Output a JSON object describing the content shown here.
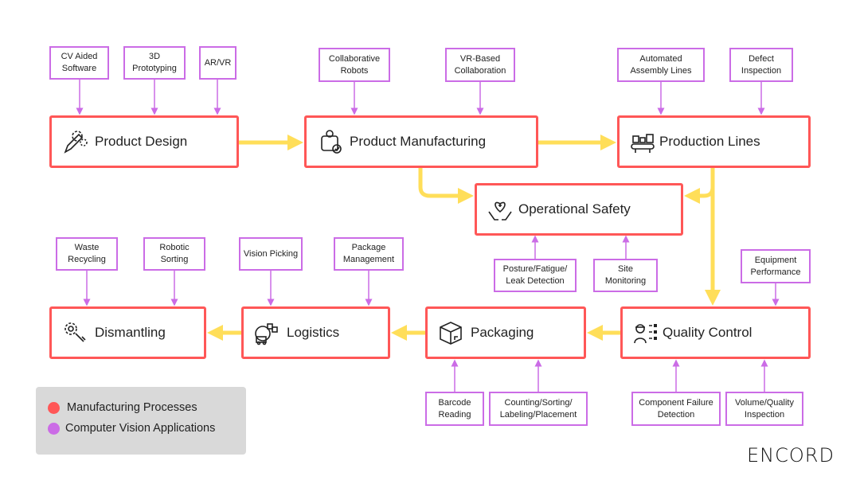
{
  "colors": {
    "process": "#ff5757",
    "cv": "#cb6ce6",
    "flow": "#ffde59"
  },
  "processes": [
    {
      "id": "pd",
      "label": "Product Design",
      "icon": "pencil-gears-icon"
    },
    {
      "id": "pm",
      "label": "Product Manufacturing",
      "icon": "robot-arm-icon"
    },
    {
      "id": "pl",
      "label": "Production Lines",
      "icon": "conveyor-icon"
    },
    {
      "id": "os",
      "label": "Operational Safety",
      "icon": "heart-hands-icon"
    },
    {
      "id": "dm",
      "label": "Dismantling",
      "icon": "gear-wrench-icon"
    },
    {
      "id": "lg",
      "label": "Logistics",
      "icon": "truck-boxes-icon"
    },
    {
      "id": "pk",
      "label": "Packaging",
      "icon": "box-icon"
    },
    {
      "id": "qc",
      "label": "Quality Control",
      "icon": "worker-checklist-icon"
    }
  ],
  "cv_apps": [
    {
      "label": "CV Aided Software"
    },
    {
      "label": "3D Prototyping"
    },
    {
      "label": "AR/VR"
    },
    {
      "label": "Collaborative Robots"
    },
    {
      "label": "VR-Based Collaboration"
    },
    {
      "label": "Automated Assembly Lines"
    },
    {
      "label": "Defect Inspection"
    },
    {
      "label": "Posture/Fatigue/ Leak Detection"
    },
    {
      "label": "Site Monitoring"
    },
    {
      "label": "Waste Recycling"
    },
    {
      "label": "Robotic Sorting"
    },
    {
      "label": "Vision Picking"
    },
    {
      "label": "Package Management"
    },
    {
      "label": "Equipment Performance"
    },
    {
      "label": "Barcode Reading"
    },
    {
      "label": "Counting/Sorting/ Labeling/Placement"
    },
    {
      "label": "Component Failure Detection"
    },
    {
      "label": "Volume/Quality Inspection"
    }
  ],
  "legend": {
    "items": [
      {
        "label": "Manufacturing Processes"
      },
      {
        "label": "Computer Vision Applications"
      }
    ]
  },
  "logo": {
    "text": "ENCORD"
  }
}
